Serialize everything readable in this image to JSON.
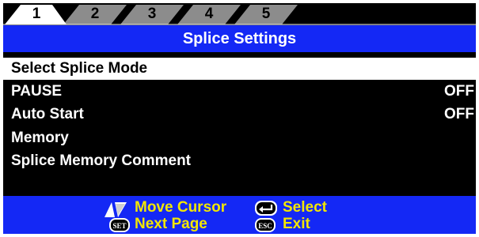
{
  "tabs": [
    {
      "label": "1",
      "active": true
    },
    {
      "label": "2",
      "active": false
    },
    {
      "label": "3",
      "active": false
    },
    {
      "label": "4",
      "active": false
    },
    {
      "label": "5",
      "active": false
    }
  ],
  "title": "Splice Settings",
  "menu": [
    {
      "label": "Select Splice Mode",
      "value": "",
      "selected": true
    },
    {
      "label": "PAUSE",
      "value": "OFF",
      "selected": false
    },
    {
      "label": "Auto Start",
      "value": "OFF",
      "selected": false
    },
    {
      "label": "Memory",
      "value": "",
      "selected": false
    },
    {
      "label": "Splice Memory Comment",
      "value": "",
      "selected": false
    }
  ],
  "footer": {
    "move_cursor": "Move Cursor",
    "select": "Select",
    "next_page": "Next Page",
    "exit": "Exit",
    "set_key": "SET",
    "esc_key": "ESC"
  },
  "colors": {
    "bar": "#1428f5",
    "hint_text": "#f2e600",
    "tab_active": "#ffffff",
    "tab_inactive": "#8c8c8c"
  }
}
